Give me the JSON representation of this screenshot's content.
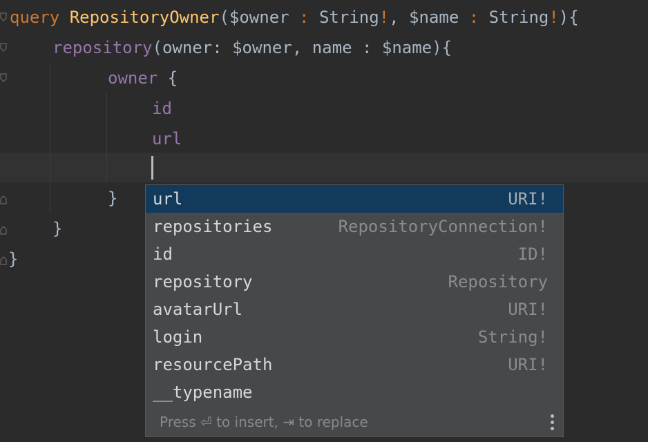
{
  "editor": {
    "lines": {
      "l1": {
        "kw": "query",
        "fn": "RepositoryOwner",
        "p1": "(",
        "v1": "$owner",
        "s1": " : ",
        "t1": "String",
        "b1": "!",
        "c1": ", ",
        "v2": "$name",
        "s2": " : ",
        "t2": "String",
        "b2": "!",
        "end": "){"
      },
      "l2": {
        "field": "repository",
        "p1": "(",
        "arg1": "owner",
        "c1": ": ",
        "v1": "$owner",
        "c2": ", ",
        "arg2": "name",
        "c3": " : ",
        "v2": "$name",
        "end": "){"
      },
      "l3": {
        "field": "owner",
        "end": " {"
      },
      "l4": {
        "field": "id"
      },
      "l5": {
        "field": "url"
      },
      "l7": {
        "brace": "}"
      },
      "l8": {
        "brace": "}"
      },
      "l9": {
        "brace": "}"
      }
    }
  },
  "completion": {
    "items": [
      {
        "name": "url",
        "type": "URI!"
      },
      {
        "name": "repositories",
        "type": "RepositoryConnection!"
      },
      {
        "name": "id",
        "type": "ID!"
      },
      {
        "name": "repository",
        "type": "Repository"
      },
      {
        "name": "avatarUrl",
        "type": "URI!"
      },
      {
        "name": "login",
        "type": "String!"
      },
      {
        "name": "resourcePath",
        "type": "URI!"
      },
      {
        "name": "__typename",
        "type": ""
      }
    ],
    "footer_hint": "Press ⏎ to insert, ⇥ to replace"
  },
  "colors": {
    "background": "#2b2b2b",
    "keyword": "#cc7832",
    "function": "#ffc66d",
    "field": "#9876aa",
    "selection": "#113a5c"
  }
}
